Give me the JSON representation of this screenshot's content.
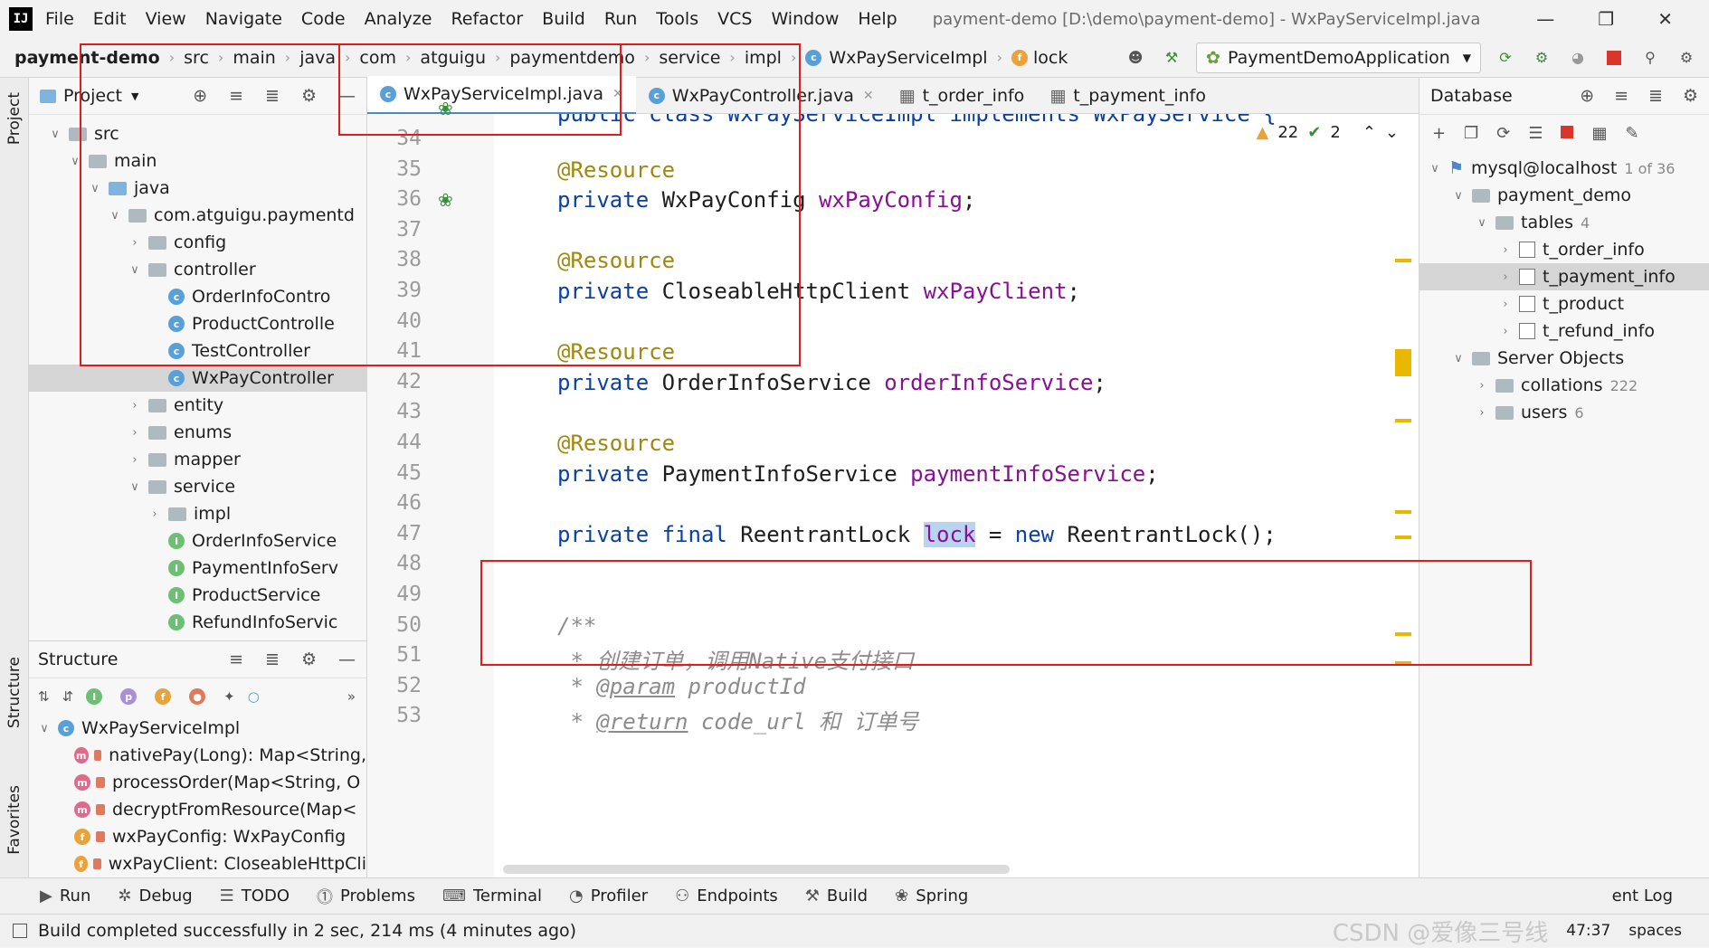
{
  "menubar": {
    "logo": "IJ",
    "items": [
      "File",
      "Edit",
      "View",
      "Navigate",
      "Code",
      "Analyze",
      "Refactor",
      "Build",
      "Run",
      "Tools",
      "VCS",
      "Window",
      "Help"
    ],
    "title": "payment-demo [D:\\demo\\payment-demo] - WxPayServiceImpl.java"
  },
  "breadcrumb": [
    "payment-demo",
    "src",
    "main",
    "java",
    "com",
    "atguigu",
    "paymentdemo",
    "service",
    "impl",
    "WxPayServiceImpl",
    "lock"
  ],
  "run_config": "PaymentDemoApplication",
  "project": {
    "title": "Project",
    "items": [
      {
        "label": "src",
        "depth": 2,
        "arrow": "v",
        "icon": "folder"
      },
      {
        "label": "main",
        "depth": 3,
        "arrow": "v",
        "icon": "folder"
      },
      {
        "label": "java",
        "depth": 4,
        "arrow": "v",
        "icon": "folder-blue"
      },
      {
        "label": "com.atguigu.paymentd",
        "depth": 5,
        "arrow": "v",
        "icon": "folder"
      },
      {
        "label": "config",
        "depth": 6,
        "arrow": ">",
        "icon": "folder"
      },
      {
        "label": "controller",
        "depth": 6,
        "arrow": "v",
        "icon": "folder"
      },
      {
        "label": "OrderInfoContro",
        "depth": 7,
        "arrow": "",
        "icon": "class"
      },
      {
        "label": "ProductControlle",
        "depth": 7,
        "arrow": "",
        "icon": "class"
      },
      {
        "label": "TestController",
        "depth": 7,
        "arrow": "",
        "icon": "class"
      },
      {
        "label": "WxPayController",
        "depth": 7,
        "arrow": "",
        "icon": "class",
        "selected": true
      },
      {
        "label": "entity",
        "depth": 6,
        "arrow": ">",
        "icon": "folder"
      },
      {
        "label": "enums",
        "depth": 6,
        "arrow": ">",
        "icon": "folder"
      },
      {
        "label": "mapper",
        "depth": 6,
        "arrow": ">",
        "icon": "folder"
      },
      {
        "label": "service",
        "depth": 6,
        "arrow": "v",
        "icon": "folder"
      },
      {
        "label": "impl",
        "depth": 7,
        "arrow": ">",
        "icon": "folder"
      },
      {
        "label": "OrderInfoService",
        "depth": 7,
        "arrow": "",
        "icon": "interface"
      },
      {
        "label": "PaymentInfoServ",
        "depth": 7,
        "arrow": "",
        "icon": "interface"
      },
      {
        "label": "ProductService",
        "depth": 7,
        "arrow": "",
        "icon": "interface"
      },
      {
        "label": "RefundInfoServic",
        "depth": 7,
        "arrow": "",
        "icon": "interface"
      }
    ]
  },
  "structure": {
    "title": "Structure",
    "root": "WxPayServiceImpl",
    "members": [
      {
        "badge": "m",
        "label": "nativePay(Long): Map<String,"
      },
      {
        "badge": "m",
        "label": "processOrder(Map<String, O"
      },
      {
        "badge": "m",
        "label": "decryptFromResource(Map<"
      },
      {
        "badge": "f",
        "label": "wxPayConfig: WxPayConfig"
      },
      {
        "badge": "f",
        "label": "wxPayClient: CloseableHttpCli"
      }
    ]
  },
  "editor_tabs": [
    {
      "label": "WxPayServiceImpl.java",
      "active": true
    },
    {
      "label": "WxPayController.java",
      "active": false
    },
    {
      "label": "t_order_info",
      "active": false
    },
    {
      "label": "t_payment_info",
      "active": false
    }
  ],
  "editor": {
    "header_line": "public class WxPayServiceImpl implements WxPayService {",
    "warnings": "22",
    "checks": "2",
    "lines": [
      {
        "n": "34",
        "parts": []
      },
      {
        "n": "35",
        "parts": [
          {
            "t": "@Resource",
            "c": "ann"
          }
        ]
      },
      {
        "n": "36",
        "parts": [
          {
            "t": "private ",
            "c": "kw"
          },
          {
            "t": "WxPayConfig ",
            "c": ""
          },
          {
            "t": "wxPayConfig",
            "c": "fld"
          },
          {
            "t": ";",
            "c": ""
          }
        ]
      },
      {
        "n": "37",
        "parts": []
      },
      {
        "n": "38",
        "parts": [
          {
            "t": "@Resource",
            "c": "ann"
          }
        ]
      },
      {
        "n": "39",
        "parts": [
          {
            "t": "private ",
            "c": "kw"
          },
          {
            "t": "CloseableHttpClient ",
            "c": ""
          },
          {
            "t": "wxPayClient",
            "c": "fld"
          },
          {
            "t": ";",
            "c": ""
          }
        ]
      },
      {
        "n": "40",
        "parts": []
      },
      {
        "n": "41",
        "parts": [
          {
            "t": "@Resource",
            "c": "ann"
          }
        ]
      },
      {
        "n": "42",
        "parts": [
          {
            "t": "private ",
            "c": "kw"
          },
          {
            "t": "OrderInfoService ",
            "c": ""
          },
          {
            "t": "orderInfoService",
            "c": "fld"
          },
          {
            "t": ";",
            "c": ""
          }
        ]
      },
      {
        "n": "43",
        "parts": []
      },
      {
        "n": "44",
        "parts": [
          {
            "t": "@Resource",
            "c": "ann"
          }
        ]
      },
      {
        "n": "45",
        "parts": [
          {
            "t": "private ",
            "c": "kw"
          },
          {
            "t": "PaymentInfoService ",
            "c": ""
          },
          {
            "t": "paymentInfoService",
            "c": "fld"
          },
          {
            "t": ";",
            "c": ""
          }
        ]
      },
      {
        "n": "46",
        "parts": []
      },
      {
        "n": "47",
        "parts": [
          {
            "t": "private final ",
            "c": "kw"
          },
          {
            "t": "ReentrantLock ",
            "c": ""
          },
          {
            "t": "lock",
            "c": "fld hl"
          },
          {
            "t": " = ",
            "c": ""
          },
          {
            "t": "new ",
            "c": "kw"
          },
          {
            "t": "ReentrantLock();",
            "c": ""
          }
        ]
      },
      {
        "n": "48",
        "parts": []
      },
      {
        "n": "49",
        "parts": []
      },
      {
        "n": "50",
        "parts": [
          {
            "t": "/**",
            "c": "cm"
          }
        ]
      },
      {
        "n": "51",
        "parts": [
          {
            "t": " * 创建订单，调用Native支付接口",
            "c": "cm"
          }
        ]
      },
      {
        "n": "52",
        "parts": [
          {
            "t": " * ",
            "c": "cm"
          },
          {
            "t": "@param",
            "c": "cmtag"
          },
          {
            "t": " productId",
            "c": "cm"
          }
        ]
      },
      {
        "n": "53",
        "parts": [
          {
            "t": " * ",
            "c": "cm"
          },
          {
            "t": "@return",
            "c": "cmtag"
          },
          {
            "t": " code_url 和 订单号",
            "c": "cm"
          }
        ]
      }
    ]
  },
  "database": {
    "title": "Database",
    "items": [
      {
        "label": "mysql@localhost",
        "extra": "1 of 36",
        "depth": 0,
        "arrow": "v"
      },
      {
        "label": "payment_demo",
        "extra": "",
        "depth": 1,
        "arrow": "v"
      },
      {
        "label": "tables",
        "extra": "4",
        "depth": 2,
        "arrow": "v"
      },
      {
        "label": "t_order_info",
        "extra": "",
        "depth": 3,
        "arrow": ">"
      },
      {
        "label": "t_payment_info",
        "extra": "",
        "depth": 3,
        "arrow": ">",
        "selected": true
      },
      {
        "label": "t_product",
        "extra": "",
        "depth": 3,
        "arrow": ">"
      },
      {
        "label": "t_refund_info",
        "extra": "",
        "depth": 3,
        "arrow": ">"
      },
      {
        "label": "Server Objects",
        "extra": "",
        "depth": 1,
        "arrow": "v"
      },
      {
        "label": "collations",
        "extra": "222",
        "depth": 2,
        "arrow": ">"
      },
      {
        "label": "users",
        "extra": "6",
        "depth": 2,
        "arrow": ">"
      }
    ]
  },
  "toolwindows": [
    "Run",
    "Debug",
    "TODO",
    "Problems",
    "Terminal",
    "Profiler",
    "Endpoints",
    "Build",
    "Spring"
  ],
  "toolwindows_right": [
    "ent Log"
  ],
  "status": {
    "message": "Build completed successfully in 2 sec, 214 ms (4 minutes ago)",
    "position": "47:37",
    "right": "spaces",
    "watermark": "CSDN @爱像三号线"
  },
  "side_tabs": {
    "project": "Project",
    "structure": "Structure",
    "favorites": "Favorites"
  },
  "colors": {
    "highlight_box": "#e21b1b",
    "keyword": "#0b3fa0",
    "annotation": "#9e880d",
    "field": "#871094"
  }
}
